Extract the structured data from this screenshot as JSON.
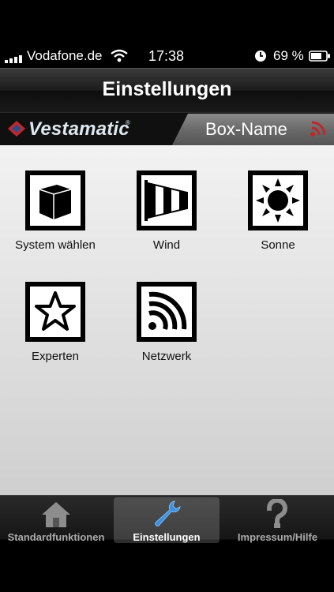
{
  "status": {
    "carrier": "Vodafone.de",
    "time": "17:38",
    "battery": "69 %"
  },
  "nav": {
    "title": "Einstellungen"
  },
  "brand": {
    "logo_text": "Vestamatic",
    "box_name": "Box-Name"
  },
  "tiles": [
    {
      "label": "System wählen",
      "icon": "cube-icon"
    },
    {
      "label": "Wind",
      "icon": "windsock-icon"
    },
    {
      "label": "Sonne",
      "icon": "sun-icon"
    },
    {
      "label": "Experten",
      "icon": "star-icon"
    },
    {
      "label": "Netzwerk",
      "icon": "network-icon"
    }
  ],
  "tabs": [
    {
      "label": "Standardfunktionen",
      "icon": "home-icon",
      "selected": false
    },
    {
      "label": "Einstellungen",
      "icon": "wrench-icon",
      "selected": true
    },
    {
      "label": "Impressum/Hilfe",
      "icon": "question-icon",
      "selected": false
    }
  ],
  "colors": {
    "accent_red": "#c0272d",
    "tab_selected_blue": "#3d8fdc"
  }
}
